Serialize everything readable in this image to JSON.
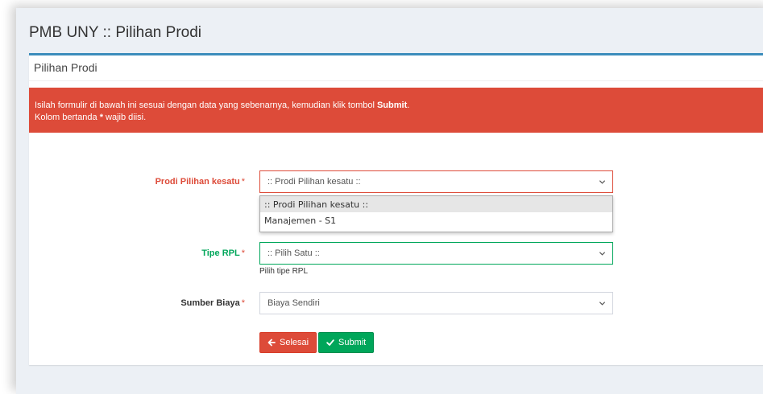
{
  "page": {
    "title": "PMB UNY :: Pilihan Prodi"
  },
  "box": {
    "title": "Pilihan Prodi"
  },
  "alert": {
    "line1_prefix": "Isilah formulir di bawah ini sesuai dengan data yang sebenarnya, kemudian klik tombol ",
    "line1_bold": "Submit",
    "line1_suffix": ".",
    "line2_prefix": "Kolom bertanda ",
    "line2_bold": "*",
    "line2_suffix": " wajib diisi."
  },
  "form": {
    "prodi": {
      "label": "Prodi Pilihan kesatu",
      "required_mark": "*",
      "selected": ":: Prodi Pilihan kesatu ::",
      "options": [
        ":: Prodi Pilihan kesatu ::",
        "Manajemen - S1"
      ]
    },
    "tipe_rpl": {
      "label": "Tipe RPL",
      "required_mark": "*",
      "selected": ":: Pilih Satu ::",
      "help": "Pilih tipe RPL"
    },
    "sumber_biaya": {
      "label": "Sumber Biaya",
      "required_mark": "*",
      "selected": "Biaya Sendiri"
    }
  },
  "buttons": {
    "selesai": "Selesai",
    "submit": "Submit"
  },
  "colors": {
    "danger": "#dd4b39",
    "success": "#00a65a",
    "primary": "#3c8dbc"
  },
  "icons": {
    "selesai": "arrow-left-icon",
    "submit": "check-icon",
    "select": "chevron-down-icon"
  }
}
